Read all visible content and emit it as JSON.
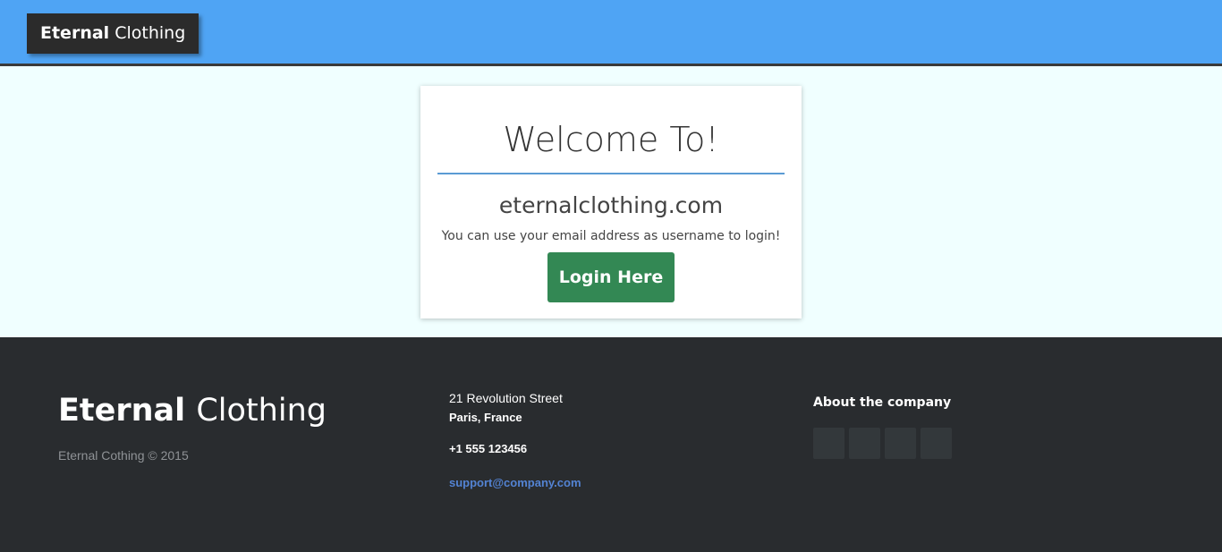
{
  "header": {
    "brand_bold": "Eternal",
    "brand_light": "Clothing"
  },
  "welcome_card": {
    "title": "Welcome To!",
    "site_name": "eternalclothing.com",
    "note": "You can use your email address as username to login!",
    "login_button_label": "Login Here"
  },
  "footer": {
    "brand_bold": "Eternal",
    "brand_light": "Clothing",
    "copyright": "Eternal Cothing © 2015",
    "address_line1": "21 Revolution Street",
    "address_line2": "Paris, France",
    "phone": "+1 555 123456",
    "email": "support@company.com",
    "about_heading": "About the company",
    "social_buttons": [
      "social-button-1",
      "social-button-2",
      "social-button-3",
      "social-button-4"
    ]
  },
  "colors": {
    "header_bg": "#4fa4f4",
    "brand_bg": "#2b2b2b",
    "main_bg": "#f0ffff",
    "divider": "#5a9bd4",
    "login_button": "#338854",
    "footer_bg": "#292c2f",
    "email_link": "#5383d3"
  }
}
